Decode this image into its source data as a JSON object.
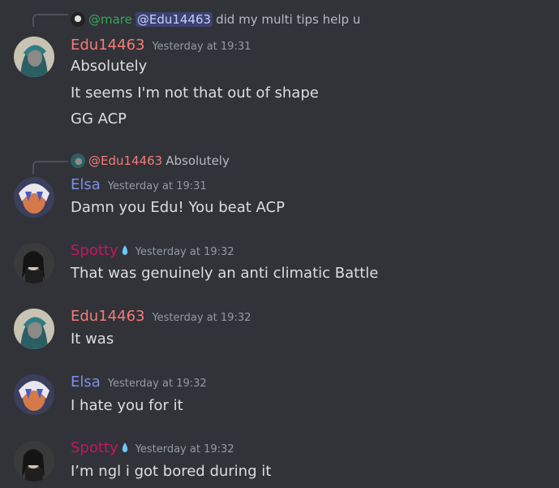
{
  "messages": [
    {
      "reply": {
        "author": "@mare",
        "mention": "@Edu14463",
        "text": "did my multi tips help u"
      },
      "author": "Edu14463",
      "timestamp": "Yesterday at 19:31",
      "lines": [
        "Absolutely",
        "It seems I'm not that out of shape",
        "GG ACP"
      ]
    },
    {
      "reply": {
        "author": "@Edu14463",
        "text": "Absolutely"
      },
      "author": "Elsa",
      "timestamp": "Yesterday at 19:31",
      "lines": [
        "Damn you Edu! You beat ACP"
      ]
    },
    {
      "author": "Spotty",
      "timestamp": "Yesterday at 19:32",
      "lines": [
        "That was genuinely an anti climatic Battle"
      ]
    },
    {
      "author": "Edu14463",
      "timestamp": "Yesterday at 19:32",
      "lines": [
        "It was"
      ]
    },
    {
      "author": "Elsa",
      "timestamp": "Yesterday at 19:32",
      "lines": [
        "I hate you for it"
      ]
    },
    {
      "author": "Spotty",
      "timestamp": "Yesterday at 19:32",
      "lines": [
        "I’m ngl i got bored during it"
      ]
    }
  ],
  "colors": {
    "background": "#313338",
    "edu": "#f47b7b",
    "elsa": "#7c8fe8",
    "spotty": "#c2185b",
    "mare": "#3ba55d",
    "timestamp": "#949ba4",
    "text": "#dbdee1"
  },
  "icons": {
    "spotty_badge": "water-drop-icon"
  }
}
